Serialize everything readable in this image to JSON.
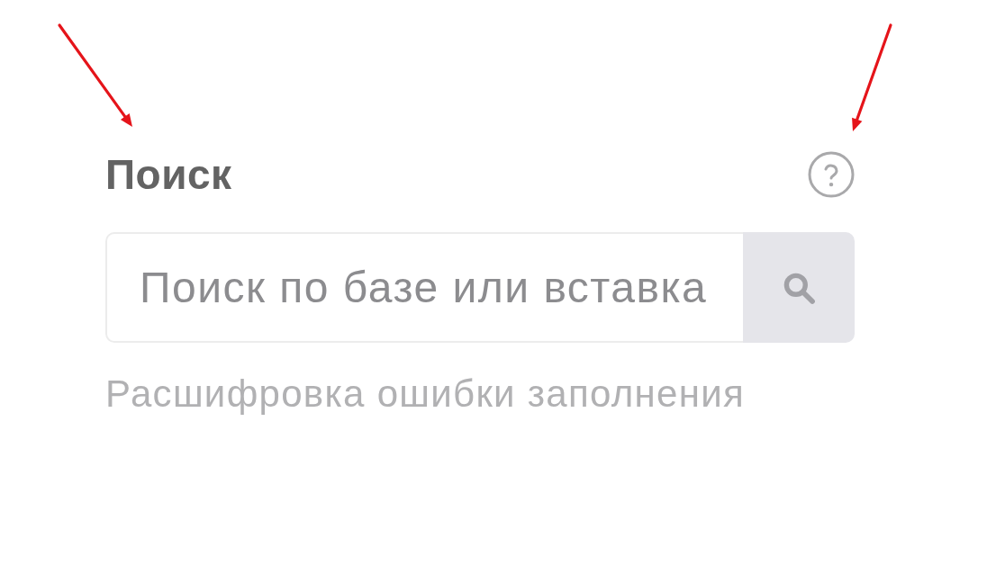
{
  "header": {
    "title": "Поиск"
  },
  "search": {
    "placeholder": "Поиск по базе или вставка"
  },
  "hint_link": {
    "text": "Расшифровка ошибки заполнения"
  }
}
